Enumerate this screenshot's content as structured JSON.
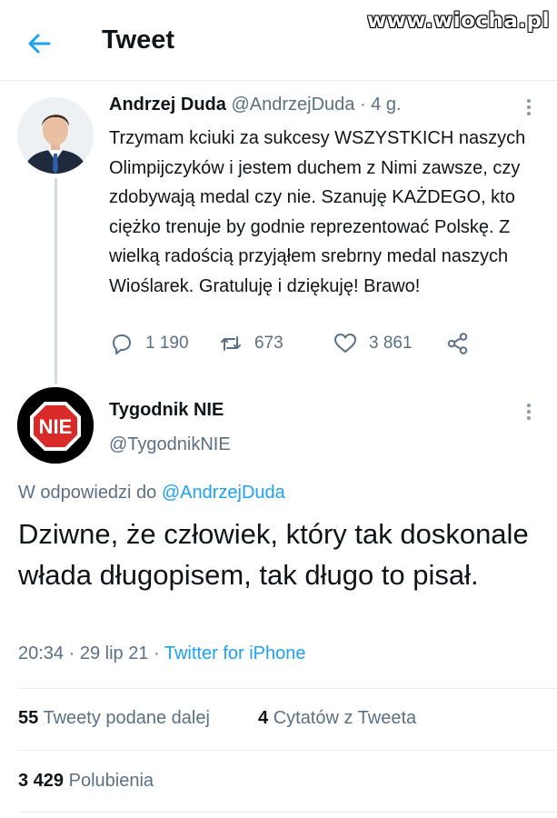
{
  "header": {
    "title": "Tweet"
  },
  "watermark": "www.wiocha.pl",
  "original_tweet": {
    "author_name": "Andrzej Duda",
    "author_handle": "@AndrzejDuda",
    "time": "· 4 g.",
    "text": "Trzymam kciuki za sukcesy WSZYSTKICH naszych Olimpijczyków i jestem duchem z Nimi zawsze, czy zdobywają medal czy nie. Szanuję KAŻDEGO, kto ciężko trenuje by godnie reprezentować Polskę. Z wielką radością przyjąłem srebrny medal naszych Wioślarek. Gratuluję i dziękuję! Brawo!",
    "replies": "1 190",
    "retweets": "673",
    "likes": "3 861"
  },
  "reply_tweet": {
    "author_name": "Tygodnik NIE",
    "author_handle": "@TygodnikNIE",
    "avatar_text": "NIE",
    "reply_to_prefix": "W odpowiedzi do",
    "reply_to_handle": "@AndrzejDuda",
    "text": "Dziwne, że człowiek, który tak doskonale włada długopisem, tak długo to pisał.",
    "time": "20:34 · 29 lip 21 ·",
    "source": "Twitter for iPhone",
    "retweets_count": "55",
    "retweets_label": "Tweety podane dalej",
    "quotes_count": "4",
    "quotes_label": "Cytatów z Tweeta",
    "likes_count": "3 429",
    "likes_label": "Polubienia"
  },
  "colors": {
    "accent": "#1da1f2",
    "secondary_text": "#5b7083",
    "stop_sign_red": "#d92a2a"
  }
}
